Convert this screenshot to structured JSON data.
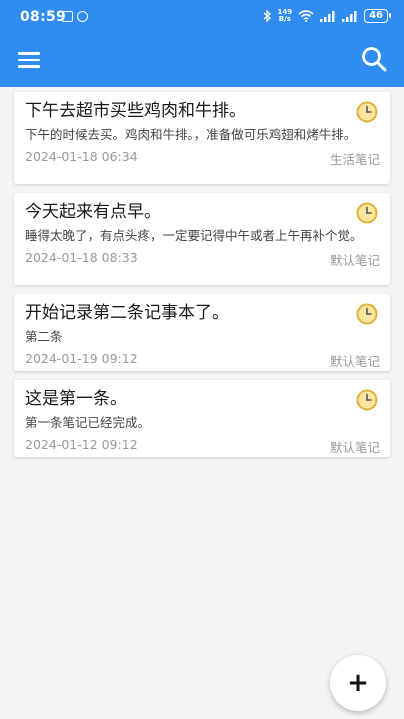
{
  "status_bar": {
    "time": "08:59",
    "net_speed_top": "149",
    "net_speed_bottom": "B/s",
    "battery": "46"
  },
  "toolbar": {
    "menu_icon": "hamburger-menu-icon",
    "search_icon": "search-icon",
    "color": "#2f8cf0"
  },
  "notes": [
    {
      "title": "下午去超市买些鸡肉和牛排。",
      "body": "下午的时候去买。鸡肉和牛排。，准备做可乐鸡翅和烤牛排。",
      "date": "2024-01-18 06:34",
      "category": "生活笔记"
    },
    {
      "title": "今天起来有点早。",
      "body": "睡得太晚了，有点头疼，一定要记得中午或者上午再补个觉。",
      "date": "2024-01-18 08:33",
      "category": "默认笔记"
    },
    {
      "title": "开始记录第二条记事本了。",
      "body": "第二条",
      "date": "2024-01-19 09:12",
      "category": "默认笔记"
    },
    {
      "title": "这是第一条。",
      "body": "第一条笔记已经完成。",
      "date": "2024-01-12 09:12",
      "category": "默认笔记"
    }
  ],
  "fab": {
    "label": "+"
  }
}
